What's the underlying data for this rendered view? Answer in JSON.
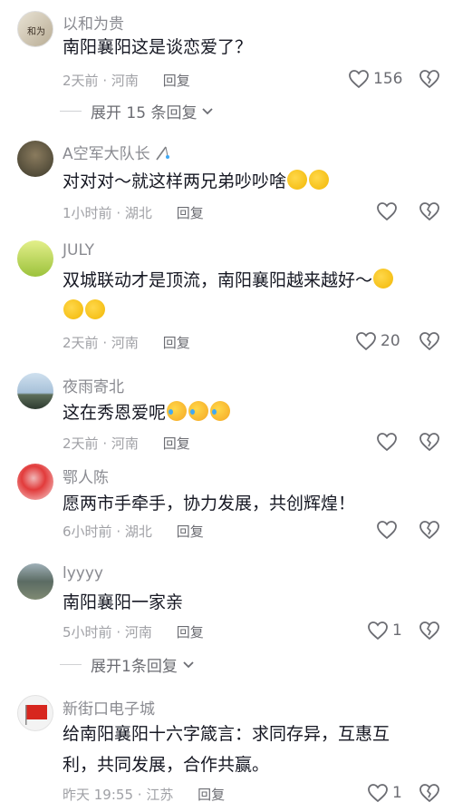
{
  "comments": [
    {
      "username": "以和为贵",
      "text": "南阳襄阳这是谈恋爱了？",
      "time": "2天前",
      "location": "河南",
      "reply": "回复",
      "likes": "156",
      "expand": "展开 15 条回复"
    },
    {
      "username": "A空军大队长",
      "text": "对对对～就这样两兄弟吵吵啥",
      "time": "1小时前",
      "location": "湖北",
      "reply": "回复",
      "likes": ""
    },
    {
      "username": "JULY",
      "text": "双城联动才是顶流，南阳襄阳越来越好～",
      "time": "2天前",
      "location": "河南",
      "reply": "回复",
      "likes": "20"
    },
    {
      "username": "夜雨寄北",
      "text": "这在秀恩爱呢",
      "time": "2天前",
      "location": "河南",
      "reply": "回复",
      "likes": ""
    },
    {
      "username": "鄂人陈",
      "text": "愿两市手牵手，协力发展，共创辉煌！",
      "time": "6小时前",
      "location": "湖北",
      "reply": "回复",
      "likes": ""
    },
    {
      "username": "lyyyy",
      "text": "南阳襄阳一家亲",
      "time": "5小时前",
      "location": "河南",
      "reply": "回复",
      "likes": "1",
      "expand": "展开1条回复"
    },
    {
      "username": "新街口电子城",
      "text_line1": "给南阳襄阳十六字箴言：求同存异，互惠互",
      "text_line2": "利，共同发展，合作共赢。",
      "time": "昨天 19:55",
      "location": "江苏",
      "reply": "回复",
      "likes": "1"
    }
  ],
  "separator": "·",
  "colors": {
    "text": "#161823",
    "muted": "#8a8b91",
    "meta": "#a0a1a6"
  }
}
